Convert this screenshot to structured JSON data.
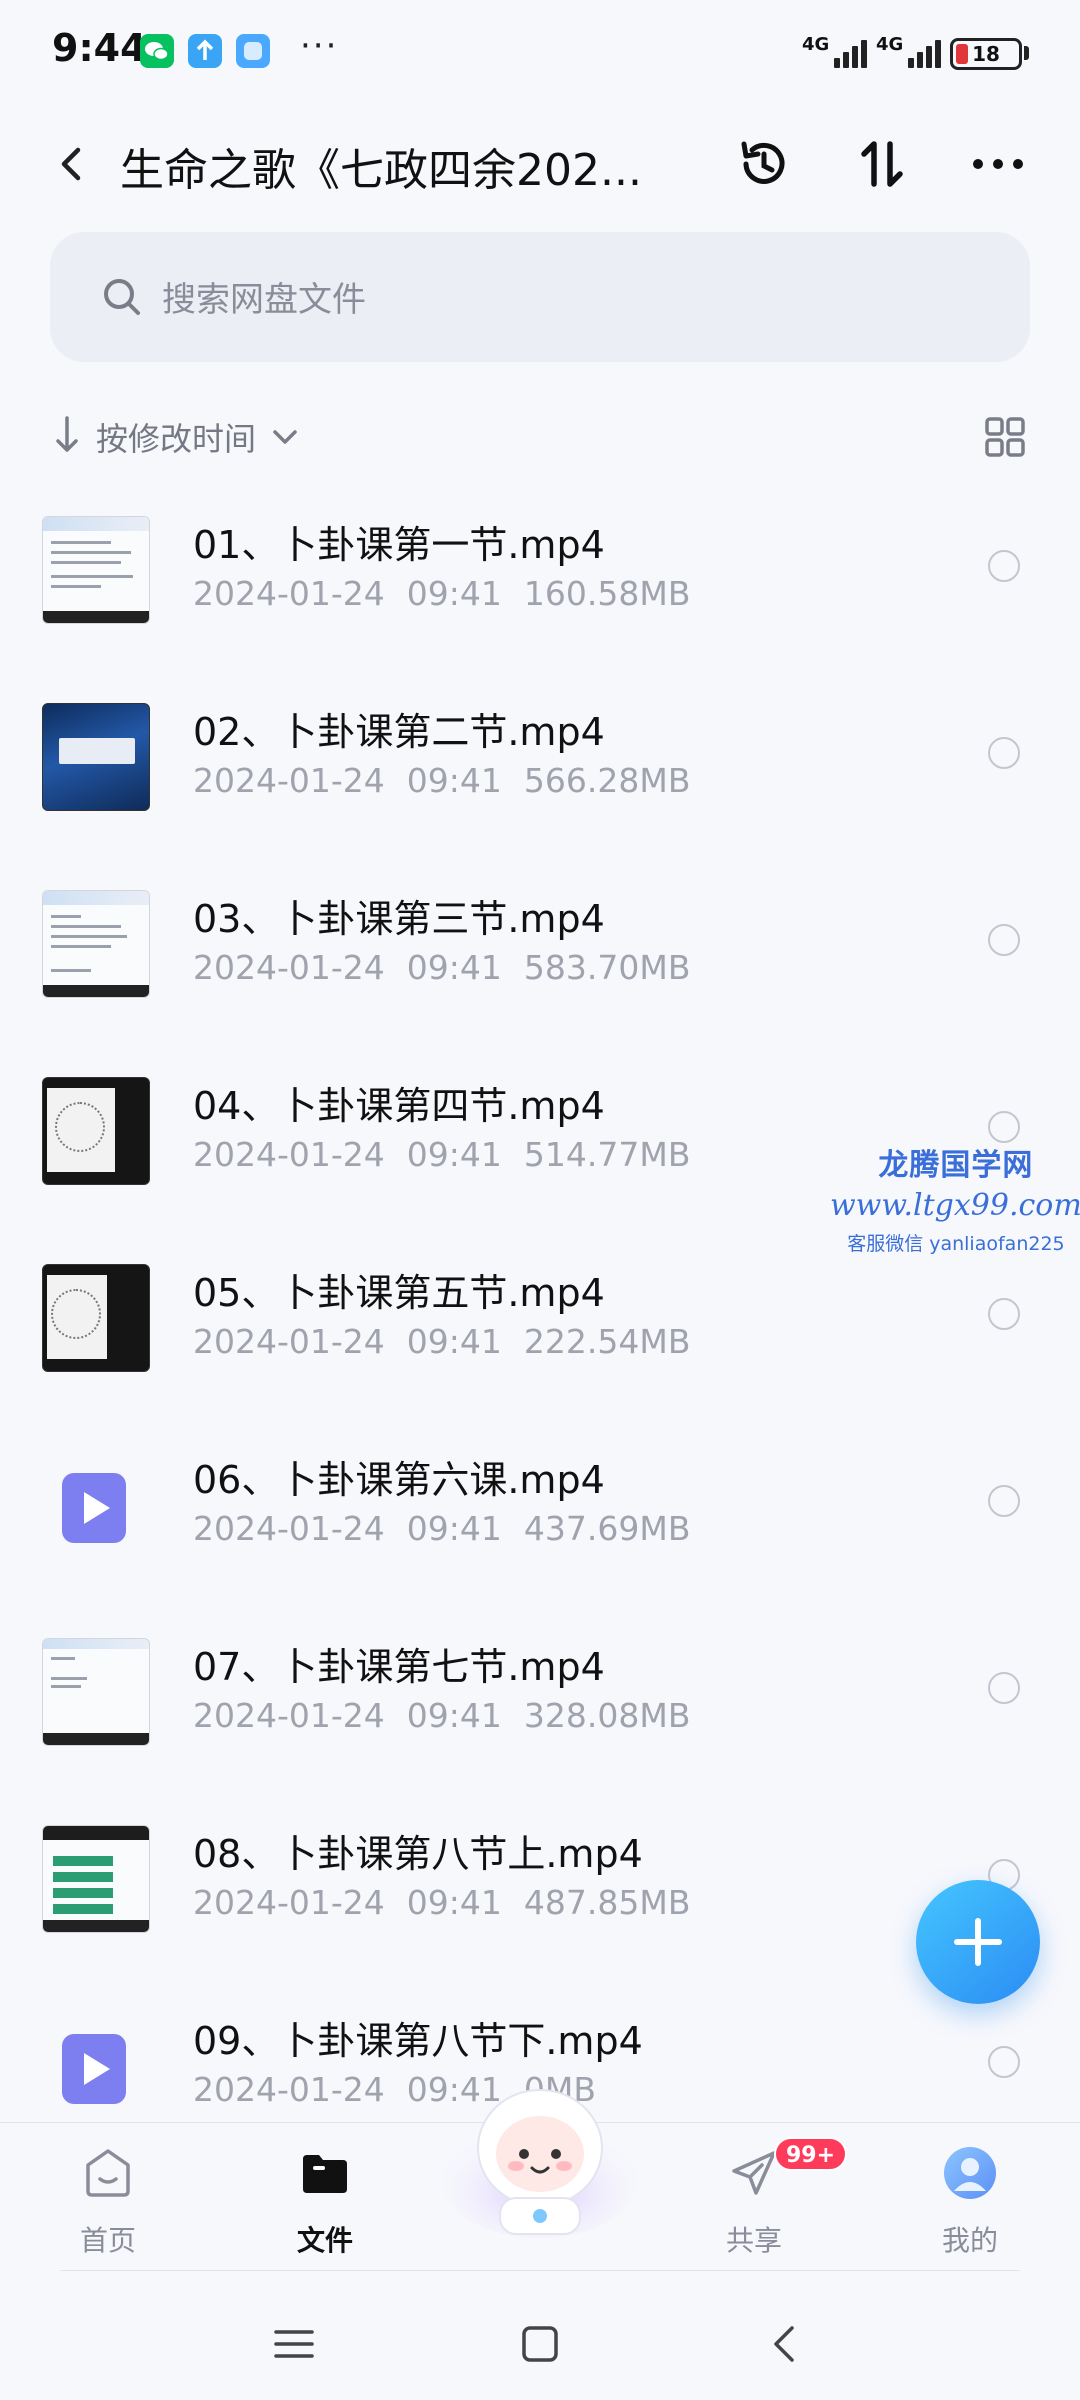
{
  "status_bar": {
    "time": "9:44",
    "dots": "···",
    "network_1": "4G",
    "network_2": "4G",
    "battery": "18"
  },
  "header": {
    "title": "生命之歌《七政四余202..."
  },
  "search": {
    "placeholder": "搜索网盘文件"
  },
  "sort": {
    "label": "按修改时间"
  },
  "files": [
    {
      "name": "01、卜卦课第一节.mp4",
      "date": "2024-01-24",
      "time": "09:41",
      "size": "160.58MB",
      "thumb": "doc"
    },
    {
      "name": "02、卜卦课第二节.mp4",
      "date": "2024-01-24",
      "time": "09:41",
      "size": "566.28MB",
      "thumb": "blue"
    },
    {
      "name": "03、卜卦课第三节.mp4",
      "date": "2024-01-24",
      "time": "09:41",
      "size": "583.70MB",
      "thumb": "doc"
    },
    {
      "name": "04、卜卦课第四节.mp4",
      "date": "2024-01-24",
      "time": "09:41",
      "size": "514.77MB",
      "thumb": "dark"
    },
    {
      "name": "05、卜卦课第五节.mp4",
      "date": "2024-01-24",
      "time": "09:41",
      "size": "222.54MB",
      "thumb": "dark"
    },
    {
      "name": "06、卜卦课第六课.mp4",
      "date": "2024-01-24",
      "time": "09:41",
      "size": "437.69MB",
      "thumb": "video-icon"
    },
    {
      "name": "07、卜卦课第七节.mp4",
      "date": "2024-01-24",
      "time": "09:41",
      "size": "328.08MB",
      "thumb": "doc"
    },
    {
      "name": "08、卜卦课第八节上.mp4",
      "date": "2024-01-24",
      "time": "09:41",
      "size": "487.85MB",
      "thumb": "green"
    },
    {
      "name": "09、卜卦课第八节下.mp4",
      "date": "2024-01-24",
      "time": "09:41",
      "size": "0MB",
      "thumb": "video-icon"
    }
  ],
  "watermark": {
    "line1": "龙腾国学网",
    "line2": "www.ltgx99.com",
    "line3": "客服微信 yanliaofan225"
  },
  "bottom_nav": {
    "home": "首页",
    "files": "文件",
    "share": "共享",
    "share_badge": "99+",
    "me": "我的"
  },
  "colors": {
    "accent": "#2b8cf3",
    "badge": "#ff3b5c",
    "video_icon": "#7d7ef0"
  }
}
